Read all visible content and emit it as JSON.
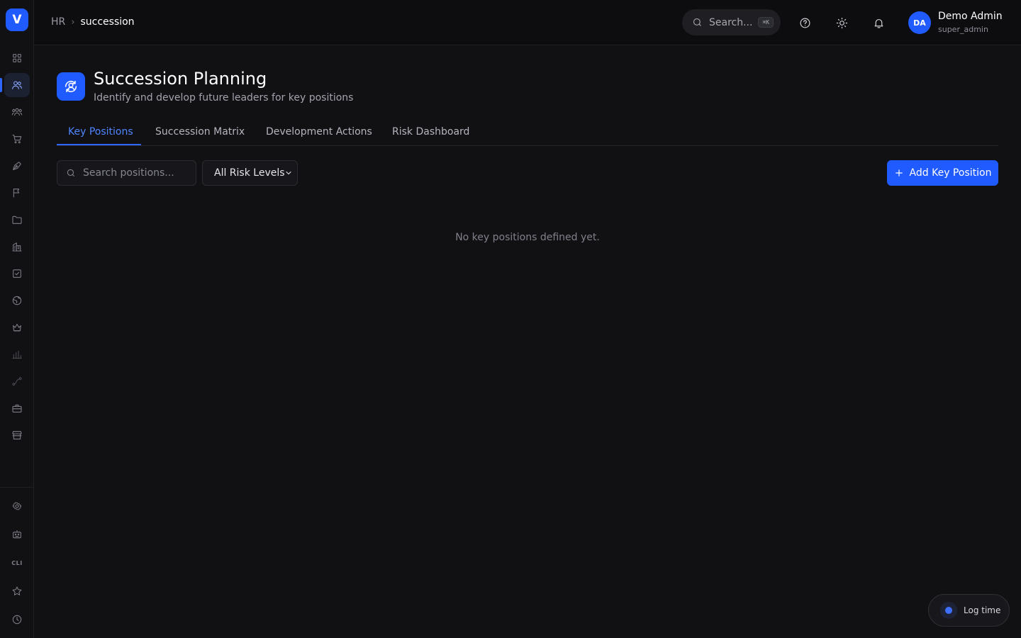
{
  "app": {
    "logo_letter": "V",
    "accent_color": "#1f5bff"
  },
  "sidebar": {
    "items": [
      {
        "icon": "grid-icon"
      },
      {
        "icon": "users-icon",
        "active": true
      },
      {
        "icon": "team-icon"
      },
      {
        "icon": "cart-icon"
      },
      {
        "icon": "pen-tool-icon"
      },
      {
        "icon": "flag-icon"
      },
      {
        "icon": "folder-icon"
      },
      {
        "icon": "building-icon"
      },
      {
        "icon": "checkbox-icon"
      },
      {
        "icon": "globe-icon"
      },
      {
        "icon": "crown-icon"
      },
      {
        "icon": "bar-chart-icon"
      },
      {
        "icon": "route-icon"
      },
      {
        "icon": "briefcase-icon"
      },
      {
        "icon": "store-icon"
      }
    ],
    "bottom_items": [
      {
        "icon": "settings-icon"
      },
      {
        "icon": "robot-icon"
      },
      {
        "icon": "cli-icon",
        "label": "CLI"
      },
      {
        "icon": "star-icon"
      },
      {
        "icon": "clock-icon"
      }
    ]
  },
  "header": {
    "breadcrumb": {
      "root": "HR",
      "current": "succession"
    },
    "search": {
      "label": "Search...",
      "shortcut": "⌘K"
    },
    "user": {
      "initials": "DA",
      "name": "Demo Admin",
      "role": "super_admin"
    }
  },
  "page": {
    "title": "Succession Planning",
    "subtitle": "Identify and develop future leaders for key positions"
  },
  "tabs": [
    {
      "label": "Key Positions",
      "active": true
    },
    {
      "label": "Succession Matrix"
    },
    {
      "label": "Development Actions"
    },
    {
      "label": "Risk Dashboard"
    }
  ],
  "toolbar": {
    "search_placeholder": "Search positions...",
    "risk_filter": "All Risk Levels",
    "add_button": "Add Key Position"
  },
  "empty_state": "No key positions defined yet.",
  "log_time": {
    "label": "Log time"
  }
}
